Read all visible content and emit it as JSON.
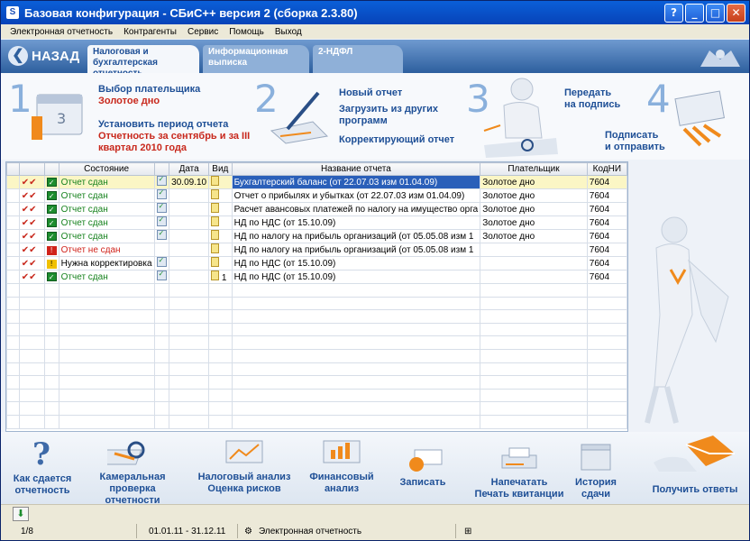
{
  "window": {
    "title": "Базовая конфигурация - СБиС++ версия 2 (сборка 2.3.80)"
  },
  "menu": [
    "Электронная отчетность",
    "Контрагенты",
    "Сервис",
    "Помощь",
    "Выход"
  ],
  "header": {
    "back_label": "НАЗАД",
    "tabs": [
      {
        "line1": "Налоговая и",
        "line2": "бухгалтерская отчетность",
        "active": true
      },
      {
        "line1": "Информационная",
        "line2": "выписка",
        "active": false
      },
      {
        "line1": "2-НДФЛ",
        "line2": "",
        "active": false
      }
    ]
  },
  "steps": {
    "s1": {
      "num": "1",
      "choose_payer": "Выбор плательщика",
      "payer": "Золотое дно",
      "set_period": "Установить период отчета",
      "period_l1": "Отчетность за сентябрь и за III",
      "period_l2": "квартал 2010 года"
    },
    "s2": {
      "num": "2",
      "new_report": "Новый отчет",
      "load_l1": "Загрузить из других",
      "load_l2": "программ",
      "correcting": "Корректирующий отчет"
    },
    "s3": {
      "num": "3",
      "send_l1": "Передать",
      "send_l2": "на подпись"
    },
    "s4": {
      "num": "4",
      "sign_l1": "Подписать",
      "sign_l2": "и отправить"
    }
  },
  "grid": {
    "columns": [
      "Состояние",
      "Дата",
      "Вид",
      "Название отчета",
      "Плательщик",
      "КодНИ"
    ],
    "rows": [
      {
        "status": "Отчет сдан",
        "status_kind": "ok",
        "date": "30.09.10",
        "vid": "",
        "name": "Бухгалтерский баланс (от 22.07.03 изм 01.04.09)",
        "payer": "Золотое дно",
        "code": "7604"
      },
      {
        "status": "Отчет сдан",
        "status_kind": "ok",
        "date": "",
        "vid": "",
        "name": "Отчет о прибылях и убытках (от 22.07.03 изм 01.04.09)",
        "payer": "Золотое дно",
        "code": "7604"
      },
      {
        "status": "Отчет сдан",
        "status_kind": "ok",
        "date": "",
        "vid": "",
        "name": "Расчет авансовых платежей по налогу на имущество орга",
        "payer": "Золотое дно",
        "code": "7604"
      },
      {
        "status": "Отчет сдан",
        "status_kind": "ok",
        "date": "",
        "vid": "",
        "name": "НД по НДС (от 15.10.09)",
        "payer": "Золотое дно",
        "code": "7604"
      },
      {
        "status": "Отчет сдан",
        "status_kind": "ok",
        "date": "",
        "vid": "",
        "name": "НД по налогу на прибыль организаций (от 05.05.08 изм 1",
        "payer": "Золотое дно",
        "code": "7604"
      },
      {
        "status": "Отчет не сдан",
        "status_kind": "bad",
        "date": "",
        "vid": "",
        "name": "НД по налогу на прибыль организаций (от 05.05.08 изм 1",
        "payer": "",
        "code": "7604"
      },
      {
        "status": "Нужна корректировка",
        "status_kind": "warn",
        "date": "",
        "vid": "",
        "name": "НД по НДС (от 15.10.09)",
        "payer": "",
        "code": "7604"
      },
      {
        "status": "Отчет сдан",
        "status_kind": "ok",
        "date": "",
        "vid": "1",
        "name": "НД по НДС (от 15.10.09)",
        "payer": "",
        "code": "7604"
      }
    ]
  },
  "bottom": [
    {
      "l1": "Как сдается",
      "l2": "отчетность",
      "icon": "question-icon"
    },
    {
      "l1": "Камеральная",
      "l2": "проверка отчетности",
      "icon": "magnifier-icon"
    },
    {
      "l1": "Налоговый анализ",
      "l2": "Оценка рисков",
      "icon": "chart-icon"
    },
    {
      "l1": "Финансовый",
      "l2": "анализ",
      "icon": "analysis-icon"
    },
    {
      "l1": "Записать",
      "l2": "",
      "icon": "disk-icon"
    },
    {
      "l1": "Напечатать",
      "l2": "Печать квитанции",
      "icon": "printer-icon"
    },
    {
      "l1": "История",
      "l2": "сдачи",
      "icon": "box-icon"
    },
    {
      "l1": "Получить ответы",
      "l2": "",
      "icon": "envelope-icon"
    }
  ],
  "status": {
    "page": "1/8",
    "period": "01.01.11 - 31.12.11",
    "mode": "Электронная отчетность"
  },
  "colors": {
    "accent": "#1e4f96",
    "alert": "#c8281c",
    "ok": "#16821d"
  }
}
